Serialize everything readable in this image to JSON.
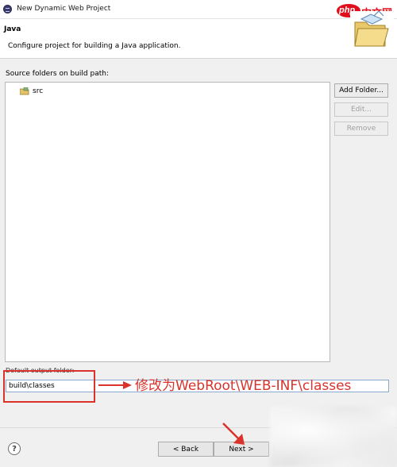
{
  "window": {
    "title": "New Dynamic Web Project"
  },
  "watermark": {
    "brand_latin": "php",
    "brand_cn": "中文网"
  },
  "header": {
    "title": "Java",
    "description": "Configure project for building a Java application."
  },
  "source_folders": {
    "label": "Source folders on build path:",
    "items": [
      {
        "label": "src",
        "icon": "source-package-icon"
      }
    ],
    "buttons": {
      "add_folder": "Add Folder...",
      "edit": "Edit...",
      "remove": "Remove"
    }
  },
  "output_folder": {
    "label": "Default output folder:",
    "value": "build\\classes"
  },
  "annotation": {
    "text": "修改为WebRoot\\WEB-INF\\classes",
    "color": "#d9332c"
  },
  "footer": {
    "help": "?",
    "back": "< Back",
    "next": "Next >"
  }
}
